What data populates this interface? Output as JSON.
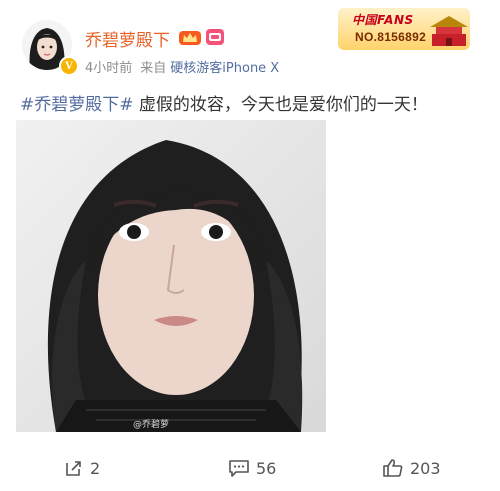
{
  "post": {
    "author": {
      "name": "乔碧萝殿下",
      "verified_icon": "verified-v-badge",
      "vip_icon": "vip-crown-icon",
      "weibo_vip_icon": "weibo-member-icon"
    },
    "time_ago": "4小时前",
    "source_prefix": "来自",
    "source_name": "硬核游客iPhone X",
    "fans_badge": {
      "title": "中国FANS",
      "number": "NO.8156892"
    },
    "text": {
      "hashtag": "#乔碧萝殿下#",
      "body": " 虚假的妆容，今天也是爱你们的一天！"
    },
    "image": {
      "watermark": "@乔碧萝"
    }
  },
  "actions": {
    "repost": {
      "count": "2",
      "icon": "share-icon"
    },
    "comment": {
      "count": "56",
      "icon": "comment-icon"
    },
    "like": {
      "count": "203",
      "icon": "thumbs-up-icon"
    }
  },
  "colors": {
    "username": "#e8632a",
    "link": "#546da0",
    "meta": "#8e8e8e"
  }
}
